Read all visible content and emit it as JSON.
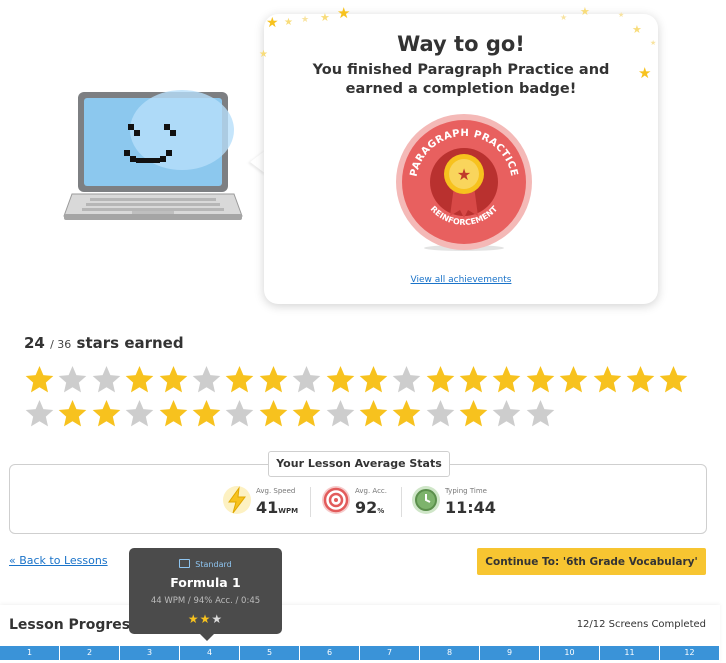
{
  "celebration": {
    "title": "Way to go!",
    "subtitle": "You finished Paragraph Practice and earned a completion badge!",
    "badge_top_text": "PARAGRAPH PRACTICE",
    "badge_bottom_text": "REINFORCEMENT",
    "view_achievements": "View all achievements"
  },
  "stars": {
    "earned": "24",
    "total": "/ 36",
    "label": "stars earned",
    "row1": [
      1,
      0,
      0,
      1,
      1,
      0,
      1,
      1,
      0,
      1,
      1,
      0,
      1,
      1,
      1,
      1,
      1,
      1,
      1,
      1
    ],
    "row2": [
      0,
      1,
      1,
      0,
      1,
      1,
      0,
      1,
      1,
      0,
      1,
      1,
      0,
      1,
      0,
      0
    ]
  },
  "stats": {
    "title": "Your Lesson Average Stats",
    "speed": {
      "label": "Avg. Speed",
      "value": "41",
      "unit": "WPM"
    },
    "accuracy": {
      "label": "Avg. Acc.",
      "value": "92",
      "unit": "%"
    },
    "time": {
      "label": "Typing Time",
      "value": "11:44"
    }
  },
  "nav": {
    "back": "« Back to Lessons",
    "continue": "Continue To: '6th Grade Vocabulary'"
  },
  "progress": {
    "title": "Lesson Progress",
    "completed": "12/12 Screens Completed",
    "segments": [
      "1",
      "2",
      "3",
      "4",
      "5",
      "6",
      "7",
      "8",
      "9",
      "10",
      "11",
      "12"
    ]
  },
  "tooltip": {
    "mode": "Standard",
    "name": "Formula 1",
    "detail": "44 WPM / 94% Acc. / 0:45",
    "stars_on": "★★",
    "stars_off": "★"
  },
  "colors": {
    "accent_blue": "#3a93d8",
    "star_gold": "#f7c21e",
    "star_grey": "#cdcdcd",
    "continue_yellow": "#f7c531",
    "badge_red": "#e8605f"
  }
}
